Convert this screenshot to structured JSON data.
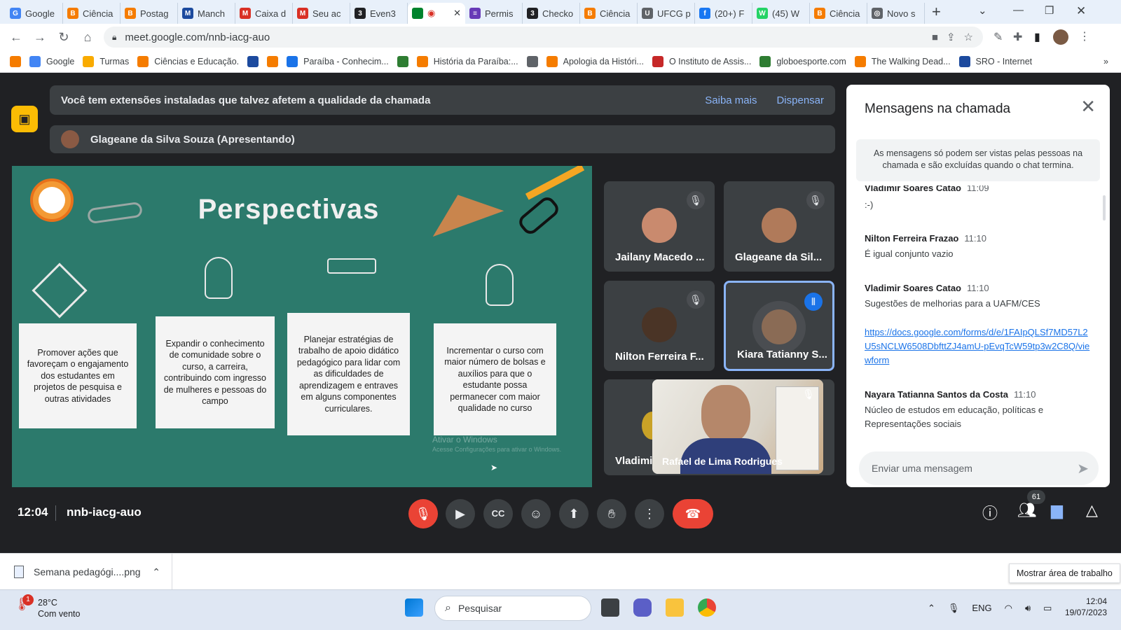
{
  "browser": {
    "tabs": [
      {
        "label": "Google",
        "fav_color": "#4285f4",
        "fav": "G"
      },
      {
        "label": "Ciência",
        "fav_color": "#f57c00",
        "fav": "B"
      },
      {
        "label": "Postag",
        "fav_color": "#f57c00",
        "fav": "B"
      },
      {
        "label": "Manch",
        "fav_color": "#1c4a9e",
        "fav": "M"
      },
      {
        "label": "Caixa d",
        "fav_color": "#d93025",
        "fav": "M"
      },
      {
        "label": "Seu ac",
        "fav_color": "#d93025",
        "fav": "M"
      },
      {
        "label": "Even3",
        "fav_color": "#202124",
        "fav": "3"
      },
      {
        "label": "",
        "fav_color": "#00832d",
        "fav": "",
        "active": true
      },
      {
        "label": "Permis",
        "fav_color": "#673ab7",
        "fav": "≡"
      },
      {
        "label": "Checko",
        "fav_color": "#202124",
        "fav": "3"
      },
      {
        "label": "Ciência",
        "fav_color": "#f57c00",
        "fav": "B"
      },
      {
        "label": "UFCG p",
        "fav_color": "#5f6368",
        "fav": "U"
      },
      {
        "label": "(20+) F",
        "fav_color": "#1877f2",
        "fav": "f"
      },
      {
        "label": "(45) W",
        "fav_color": "#25d366",
        "fav": "W"
      },
      {
        "label": "Ciência",
        "fav_color": "#f57c00",
        "fav": "B"
      },
      {
        "label": "Novo s",
        "fav_color": "#5f6368",
        "fav": "◎"
      }
    ],
    "url": "meet.google.com/nnb-iacg-auo",
    "bookmarks": [
      {
        "label": "",
        "fav_color": "#f57c00"
      },
      {
        "label": "Google",
        "fav_color": "#4285f4"
      },
      {
        "label": "Turmas",
        "fav_color": "#f9ab00"
      },
      {
        "label": "Ciências e Educação.",
        "fav_color": "#f57c00"
      },
      {
        "label": "",
        "fav_color": "#1c4a9e"
      },
      {
        "label": "",
        "fav_color": "#f57c00"
      },
      {
        "label": "Paraíba - Conhecim...",
        "fav_color": "#1a73e8"
      },
      {
        "label": "",
        "fav_color": "#2e7d32"
      },
      {
        "label": "História da Paraíba:...",
        "fav_color": "#f57c00"
      },
      {
        "label": "",
        "fav_color": "#5f6368"
      },
      {
        "label": "Apologia da Históri...",
        "fav_color": "#f57c00"
      },
      {
        "label": "O Instituto de Assis...",
        "fav_color": "#c62828"
      },
      {
        "label": "globoesporte.com",
        "fav_color": "#2e7d32"
      },
      {
        "label": "The Walking Dead...",
        "fav_color": "#f57c00"
      },
      {
        "label": "SRO - Internet",
        "fav_color": "#1c4a9e"
      }
    ],
    "bookmarks_more": "»"
  },
  "banner": {
    "text": "Você tem extensões instaladas que talvez afetem a qualidade da chamada",
    "learn_more": "Saiba mais",
    "dismiss": "Dispensar"
  },
  "presenter": {
    "label": "Glageane da Silva Souza (Apresentando)"
  },
  "slide": {
    "title": "Perspectivas",
    "columns": [
      "Promover ações que favoreçam o engajamento dos estudantes em projetos de pesquisa e outras atividades",
      "Expandir o conhecimento de comunidade sobre o curso, a carreira, contribuindo com ingresso de mulheres e pessoas do campo",
      "Planejar estratégias de trabalho de apoio didático pedagógico para lidar com as dificuldades de aprendizagem e entraves em alguns componentes curriculares.",
      "Incrementar o curso com maior número de bolsas e auxílios para que o estudante possa permanecer com maior qualidade no curso"
    ],
    "watermark_title": "Ativar o Windows",
    "watermark_sub": "Acesse Configurações para ativar o Windows."
  },
  "participants": [
    {
      "name": "Jailany Macedo ...",
      "avatar_color": "#c98a6e",
      "muted": true
    },
    {
      "name": "Glageane da Sil...",
      "avatar_color": "#b07a5a",
      "muted": true
    },
    {
      "name": "Nilton Ferreira F...",
      "avatar_color": "#4a3426",
      "muted": true
    },
    {
      "name": "Kiara Tatianny S...",
      "avatar_color": "#8a6b55",
      "muted": false,
      "speaking": true
    },
    {
      "name": "Vladimi",
      "avatar_color": "#c9a227",
      "muted": false
    },
    {
      "name": "Rafael de Lima Rodrigues",
      "muted": true,
      "video": true
    }
  ],
  "chat": {
    "title": "Mensagens na chamada",
    "note": "As mensagens só podem ser vistas pelas pessoas na chamada e são excluídas quando o chat termina.",
    "messages": [
      {
        "who": "Vladimir Soares Catao",
        "time": "11:09",
        "text": ":-)"
      },
      {
        "who": "Nilton Ferreira Frazao",
        "time": "11:10",
        "text": "É igual conjunto vazio"
      },
      {
        "who": "Vladimir Soares Catao",
        "time": "11:10",
        "text": "Sugestões de melhorias para a UAFM/CES"
      },
      {
        "who": "",
        "time": "",
        "link": "https://docs.google.com/forms/d/e/1FAIpQLSf7MD57L2U5sNCLW6508DbfttZJ4amU-pEvqTcW59tp3w2C8Q/viewform"
      },
      {
        "who": "Nayara Tatianna Santos da Costa",
        "time": "11:10",
        "text": "Núcleo de estudos em educação, políticas e Representações sociais"
      }
    ],
    "input_placeholder": "Enviar uma mensagem"
  },
  "meeting": {
    "time": "12:04",
    "code": "nnb-iacg-auo",
    "participant_count": "61"
  },
  "downloads": {
    "file": "Semana pedagógi....png",
    "tooltip": "Mostrar área de trabalho"
  },
  "taskbar": {
    "weather_temp": "28°C",
    "weather_desc": "Com vento",
    "weather_badge": "1",
    "search_placeholder": "Pesquisar",
    "lang": "ENG",
    "clock_time": "12:04",
    "clock_date": "19/07/2023"
  }
}
